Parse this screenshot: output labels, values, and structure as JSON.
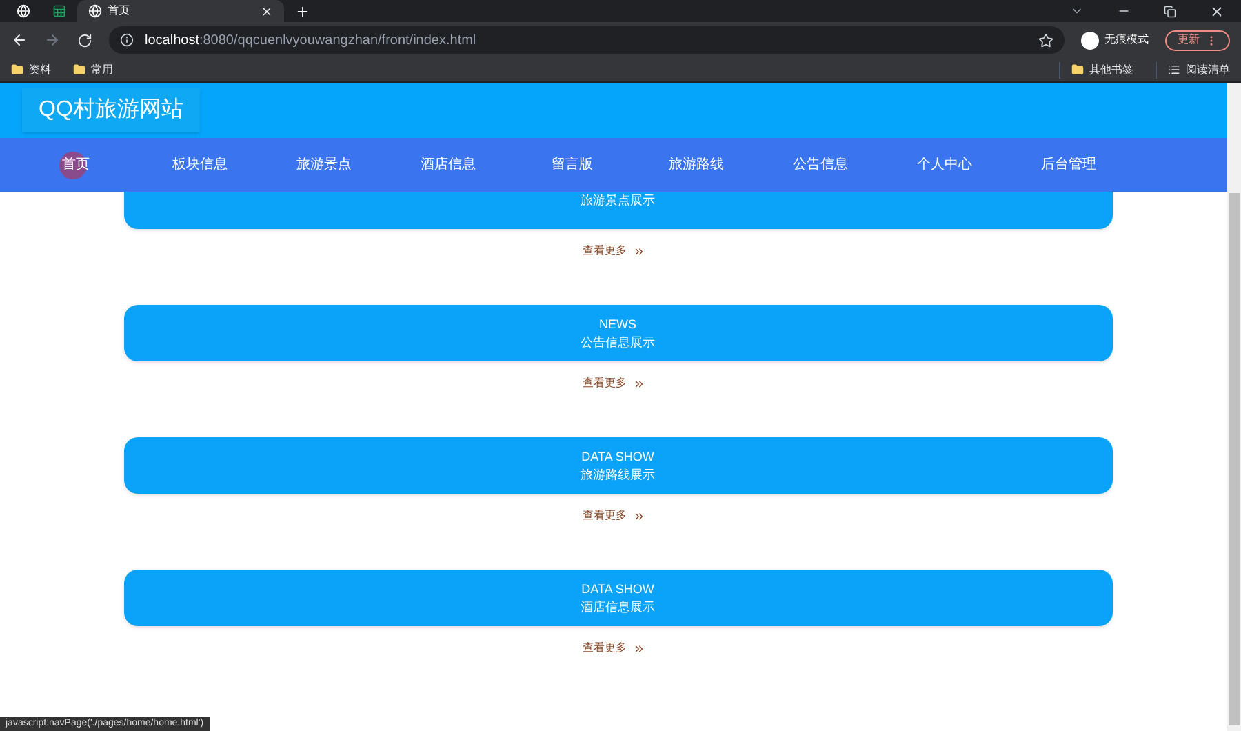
{
  "browser": {
    "tabs": [
      {
        "kind": "pinned",
        "selected": false
      },
      {
        "kind": "sheet",
        "selected": false
      },
      {
        "kind": "page",
        "title": "首页",
        "selected": true
      }
    ],
    "address": {
      "host": "localhost",
      "path": ":8080/qqcuenlvyouwangzhan/front/index.html"
    },
    "profile": "无痕模式",
    "update_button": "更新",
    "bookmarks": [
      "资料",
      "常用"
    ],
    "other_bookmarks": "其他书签",
    "reading_list": "阅读清单"
  },
  "site": {
    "title": "QQ村旅游网站",
    "nav": [
      "首页",
      "板块信息",
      "旅游景点",
      "酒店信息",
      "留言版",
      "旅游路线",
      "公告信息",
      "个人中心",
      "后台管理"
    ],
    "sections": [
      {
        "subtitle": "旅游景点展示",
        "more": "查看更多"
      },
      {
        "title": "NEWS",
        "subtitle": "公告信息展示",
        "more": "查看更多"
      },
      {
        "title": "DATA SHOW",
        "subtitle": "旅游路线展示",
        "more": "查看更多"
      },
      {
        "title": "DATA SHOW",
        "subtitle": "酒店信息展示",
        "more": "查看更多"
      }
    ]
  },
  "status_url": "javascript:navPage('./pages/home/home.html')"
}
